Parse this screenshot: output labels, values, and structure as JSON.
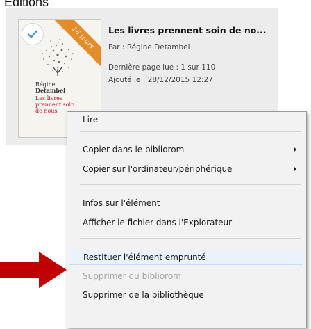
{
  "section": {
    "label": "Éditions"
  },
  "book": {
    "title": "Les livres prennent soin de no...",
    "author_label": "Par :",
    "author": "Régine Detambel",
    "last_page_label": "Dernière page lue :",
    "last_page": "1 sur 110",
    "added_label": "Ajouté le :",
    "added": "28/12/2015 12:27",
    "ribbon_text": "16 jours",
    "cover_lines": [
      "Régine",
      "Detambel",
      "Les livres",
      "prennent soin",
      "de nous"
    ]
  },
  "context_menu": {
    "items": [
      {
        "label": "Lire",
        "disabled": false,
        "submenu": false
      },
      {
        "label": "Copier dans le bibliorom",
        "disabled": false,
        "submenu": true
      },
      {
        "label": "Copier sur l'ordinateur/périphérique",
        "disabled": false,
        "submenu": true
      },
      {
        "label": "Infos sur l'élément",
        "disabled": false,
        "submenu": false
      },
      {
        "label": "Afficher le fichier dans l'Explorateur",
        "disabled": false,
        "submenu": false
      },
      {
        "label": "Restituer l'élément emprunté",
        "disabled": false,
        "submenu": false,
        "hovered": true
      },
      {
        "label": "Supprimer du bibliorom",
        "disabled": true,
        "submenu": false
      },
      {
        "label": "Supprimer de la bibliothèque",
        "disabled": false,
        "submenu": false
      }
    ]
  },
  "colors": {
    "ribbon": "#e58b2a",
    "arrow": "#c00000",
    "hover_bg": "#eaf3fb",
    "menu_bg": "#f2f2f2",
    "card_bg": "#ececec"
  },
  "icons": {
    "selected_check": "check-icon",
    "submenu": "chevron-right-icon",
    "annotation": "red-arrow-icon"
  }
}
